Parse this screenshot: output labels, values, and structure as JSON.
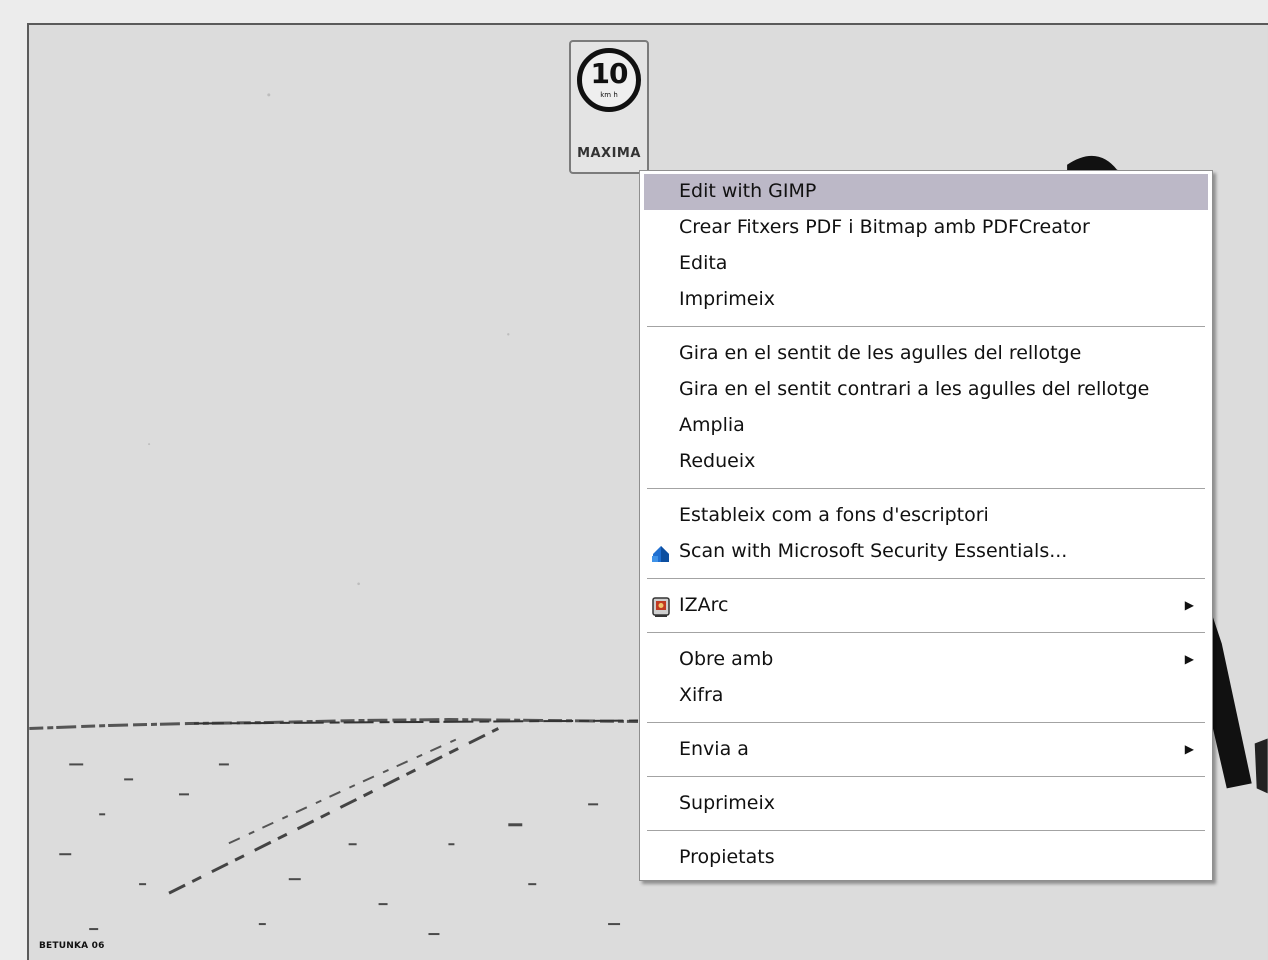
{
  "photo": {
    "sign": {
      "number": "10",
      "unit": "km h",
      "label": "MAXIMA"
    },
    "credit": "BETUNKA 06"
  },
  "context_menu": {
    "groups": [
      [
        {
          "label": "Edit with GIMP",
          "highlighted": true
        },
        {
          "label": "Crear Fitxers PDF i Bitmap amb PDFCreator"
        },
        {
          "label": "Edita"
        },
        {
          "label": "Imprimeix"
        }
      ],
      [
        {
          "label": "Gira en el sentit de les agulles del rellotge"
        },
        {
          "label": "Gira en el sentit contrari a les agulles del rellotge"
        },
        {
          "label": "Amplia"
        },
        {
          "label": "Redueix"
        }
      ],
      [
        {
          "label": "Estableix com a fons d'escriptori"
        },
        {
          "label": "Scan with Microsoft Security Essentials...",
          "icon": "security-essentials-icon"
        }
      ],
      [
        {
          "label": "IZArc",
          "icon": "izarc-icon",
          "submenu": true
        }
      ],
      [
        {
          "label": "Obre amb",
          "submenu": true
        },
        {
          "label": "Xifra"
        }
      ],
      [
        {
          "label": "Envia a",
          "submenu": true
        }
      ],
      [
        {
          "label": "Suprimeix"
        }
      ],
      [
        {
          "label": "Propietats"
        }
      ]
    ],
    "highlight_color": "#bcb8c7"
  }
}
